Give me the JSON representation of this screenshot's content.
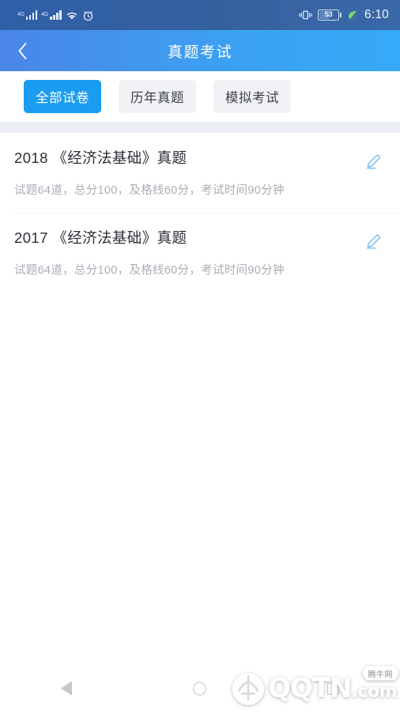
{
  "status_bar": {
    "signal_1_label": "4G",
    "signal_2_label": "4G",
    "wifi_icon": "wifi-icon",
    "alarm_icon": "alarm-clock-icon",
    "vibrate_icon": "vibrate-icon",
    "battery_level": "53",
    "power_saving_icon": "leaf-icon",
    "time": "6:10"
  },
  "header": {
    "back_icon": "chevron-left-icon",
    "title": "真题考试"
  },
  "tabs": [
    {
      "label": "全部试卷",
      "active": true
    },
    {
      "label": "历年真题",
      "active": false
    },
    {
      "label": "模拟考试",
      "active": false
    }
  ],
  "list": [
    {
      "title": "2018 《经济法基础》真题",
      "subtitle": "试题64道，总分100，及格线60分，考试时间90分钟",
      "action_icon": "pencil-edit-icon"
    },
    {
      "title": "2017 《经济法基础》真题",
      "subtitle": "试题64道，总分100，及格线60分，考试时间90分钟",
      "action_icon": "pencil-edit-icon"
    }
  ],
  "nav_bar": {
    "back_icon": "triangle-back-icon",
    "home_icon": "circle-home-icon",
    "recents_icon": "square-recents-icon"
  },
  "watermark": {
    "brand": "QQTN",
    "suffix": ".com",
    "badge": "腾牛网"
  },
  "colors": {
    "accent_blue": "#1a9cf0",
    "header_blue_left": "#4a86e8",
    "header_blue_right": "#35aaf8",
    "tab_inactive_bg": "#f1f2f5",
    "subtitle_gray": "#a9adb4",
    "pencil_blue": "#6fb8ea"
  }
}
